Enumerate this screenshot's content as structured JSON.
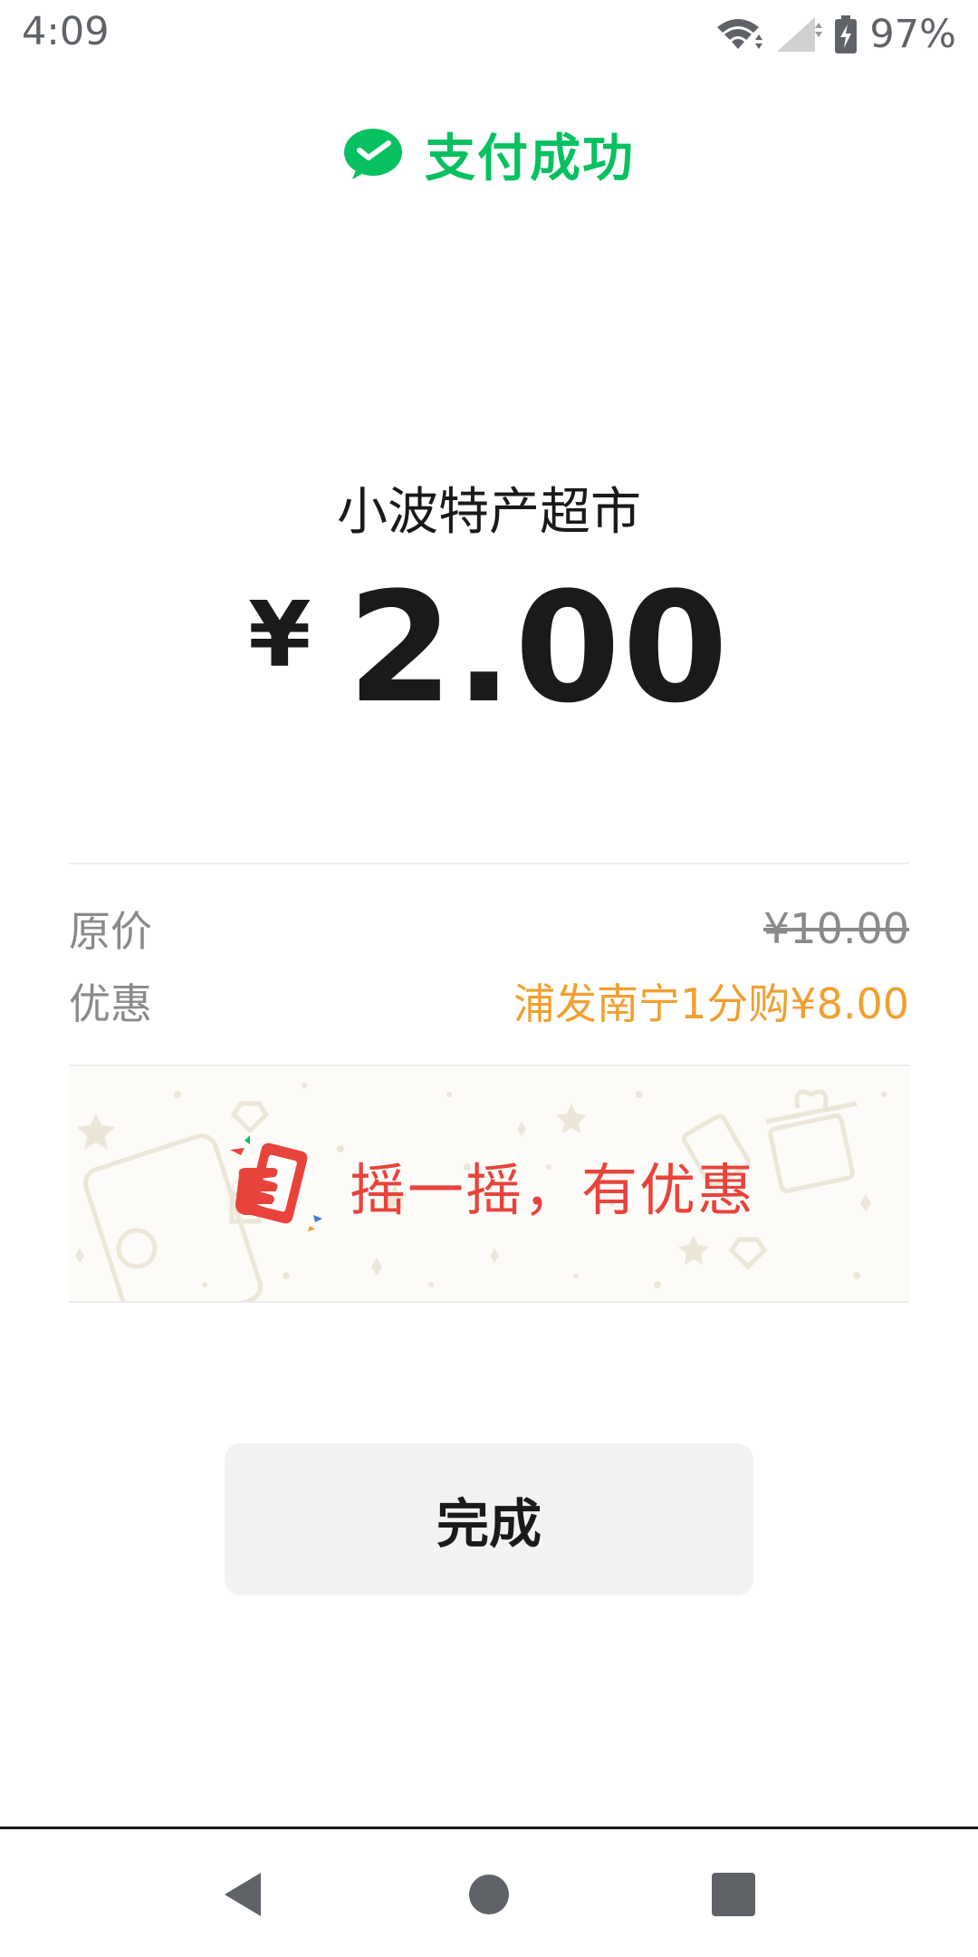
{
  "status_bar": {
    "time": "4:09",
    "battery_percent": "97%",
    "icons": [
      "wifi-icon",
      "signal-icon",
      "battery-charging-icon"
    ]
  },
  "header": {
    "icon": "wechat-pay-icon",
    "title": "支付成功",
    "accent_color": "#07c160"
  },
  "payment": {
    "merchant": "小波特产超市",
    "currency_symbol": "¥",
    "amount": "2.00"
  },
  "details": {
    "original_label": "原价",
    "original_value": "¥10.00",
    "discount_label": "优惠",
    "discount_value": "浦发南宁1分购¥8.00",
    "discount_color": "#f0a030"
  },
  "banner": {
    "icon": "shake-phone-icon",
    "text": "摇一摇，有优惠",
    "text_color": "#e8433b"
  },
  "done_button": {
    "label": "完成"
  },
  "nav": {
    "buttons": [
      "back-icon",
      "home-icon",
      "recents-icon"
    ]
  }
}
